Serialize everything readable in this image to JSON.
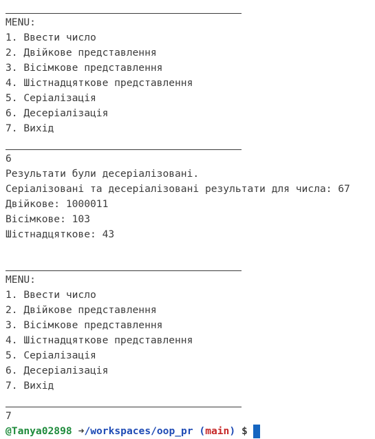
{
  "terminal": {
    "menu_header": "MENU:",
    "menu_items": [
      "1. Ввести число",
      "2. Двійкове представлення",
      "3. Вісімкове представлення",
      "4. Шістнадцяткове представлення",
      "5. Серіалізація",
      "6. Десеріалізація",
      "7. Вихід"
    ],
    "input_1": "6",
    "output_lines": [
      "Результати були десеріалізовані.",
      "Серіалізовані та десеріалізовані результати для числа: 67",
      "Двійкове: 1000011",
      "Вісімкове: 103",
      "Шістнадцяткове: 43"
    ],
    "input_2": "7",
    "prompt": {
      "user": "@Tanya02898",
      "arrow": "➜",
      "path": "/workspaces/oop_pr",
      "branch_open": "(",
      "branch": "main",
      "branch_close": ")",
      "symbol": "$"
    },
    "colors": {
      "background": "#ffffff",
      "text": "#3b3b3b",
      "user": "#1f8b3c",
      "path": "#1f4bb5",
      "branch": "#c62828",
      "cursor": "#1565c0"
    }
  }
}
